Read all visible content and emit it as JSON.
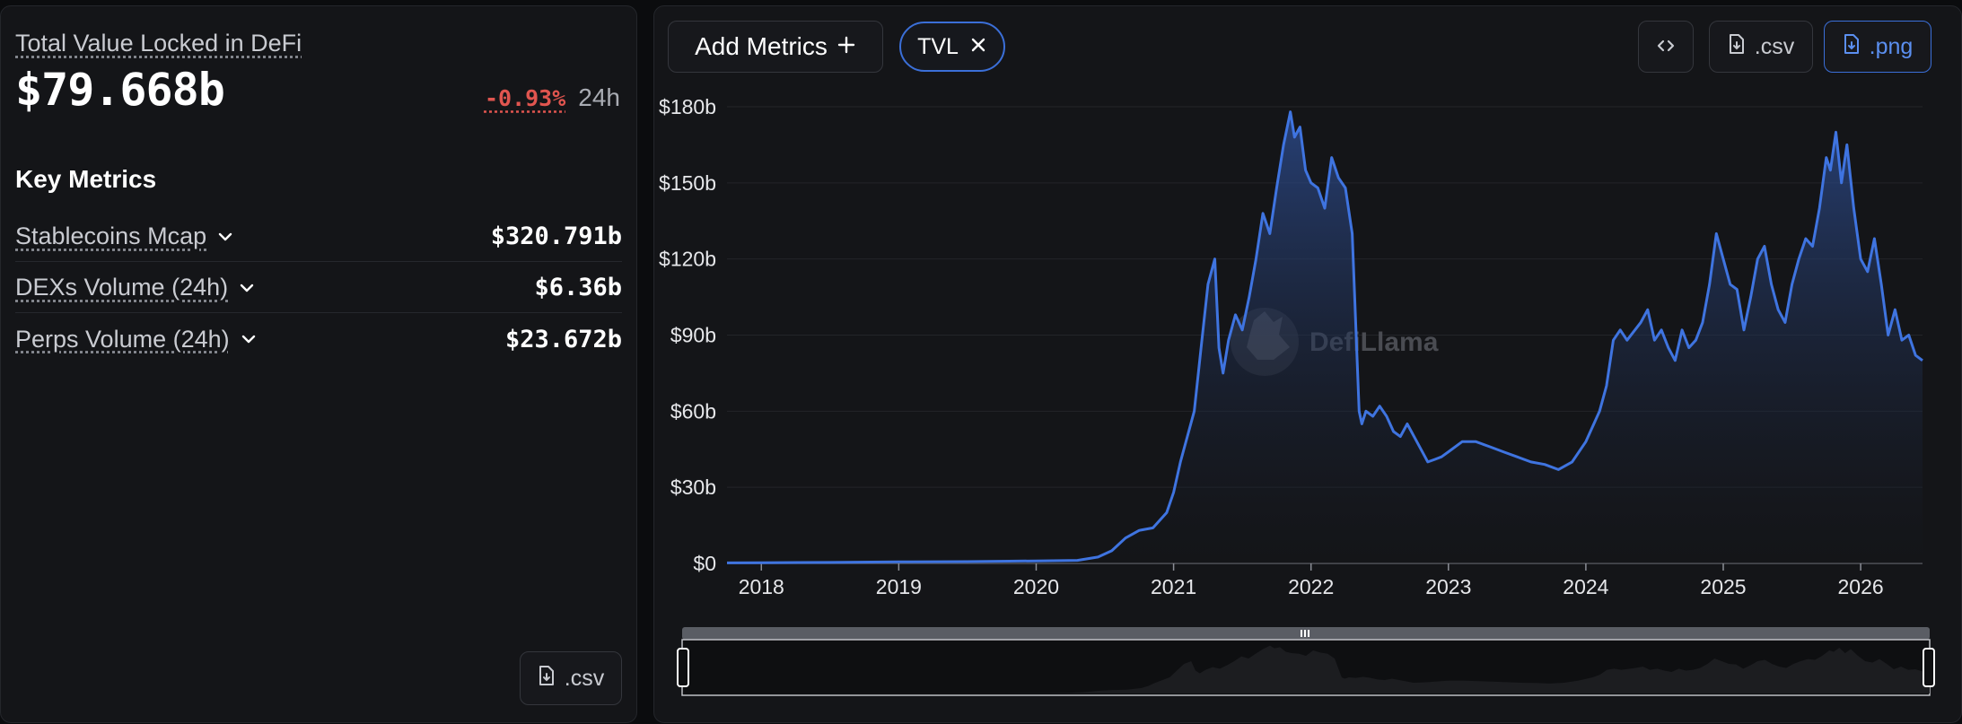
{
  "summary": {
    "title": "Total Value Locked in DeFi",
    "value": "$79.668b",
    "change": "-0.93%",
    "change_period": "24h"
  },
  "key_metrics": {
    "title": "Key Metrics",
    "items": [
      {
        "label": "Stablecoins Mcap",
        "value": "$320.791b"
      },
      {
        "label": "DEXs Volume (24h)",
        "value": "$6.36b"
      },
      {
        "label": "Perps Volume (24h)",
        "value": "$23.672b"
      }
    ]
  },
  "left_csv_label": ".csv",
  "toolbar": {
    "add_metrics_label": "Add Metrics",
    "tvl_chip_label": "TVL",
    "csv_label": ".csv",
    "png_label": ".png"
  },
  "watermark": "DefiLlama",
  "colors": {
    "accent": "#3b6fd8",
    "negative": "#e0554f",
    "line": "#3f74e0"
  },
  "chart_data": {
    "type": "area",
    "y_tick_labels": [
      "$0",
      "$30b",
      "$60b",
      "$90b",
      "$120b",
      "$150b",
      "$180b"
    ],
    "x_tick_labels": [
      "2018",
      "2019",
      "2020",
      "2021",
      "2022",
      "2023",
      "2024",
      "2025",
      "2026"
    ],
    "ylim": [
      0,
      180
    ],
    "xlim": [
      2017.75,
      2026.45
    ],
    "grid": true,
    "series": [
      {
        "values_unit": "billion USD",
        "x": [
          2017.75,
          2018.0,
          2018.5,
          2019.0,
          2019.5,
          2019.8,
          2020.0,
          2020.3,
          2020.45,
          2020.55,
          2020.65,
          2020.75,
          2020.85,
          2020.95,
          2021.0,
          2021.05,
          2021.1,
          2021.15,
          2021.2,
          2021.25,
          2021.3,
          2021.33,
          2021.36,
          2021.4,
          2021.45,
          2021.5,
          2021.55,
          2021.6,
          2021.65,
          2021.7,
          2021.75,
          2021.8,
          2021.85,
          2021.88,
          2021.92,
          2021.96,
          2022.0,
          2022.05,
          2022.1,
          2022.15,
          2022.2,
          2022.25,
          2022.3,
          2022.35,
          2022.37,
          2022.4,
          2022.45,
          2022.5,
          2022.55,
          2022.6,
          2022.65,
          2022.7,
          2022.75,
          2022.8,
          2022.85,
          2022.9,
          2022.95,
          2023.0,
          2023.1,
          2023.2,
          2023.3,
          2023.4,
          2023.5,
          2023.6,
          2023.7,
          2023.8,
          2023.9,
          2024.0,
          2024.1,
          2024.15,
          2024.2,
          2024.25,
          2024.3,
          2024.4,
          2024.45,
          2024.5,
          2024.55,
          2024.6,
          2024.65,
          2024.7,
          2024.75,
          2024.8,
          2024.85,
          2024.9,
          2024.95,
          2025.0,
          2025.05,
          2025.1,
          2025.15,
          2025.2,
          2025.25,
          2025.3,
          2025.35,
          2025.4,
          2025.45,
          2025.5,
          2025.55,
          2025.6,
          2025.65,
          2025.7,
          2025.75,
          2025.78,
          2025.82,
          2025.86,
          2025.9,
          2025.95,
          2026.0,
          2026.05,
          2026.1,
          2026.15,
          2026.2,
          2026.25,
          2026.3,
          2026.35,
          2026.4,
          2026.45
        ],
        "y": [
          0.2,
          0.3,
          0.4,
          0.6,
          0.7,
          0.9,
          1.0,
          1.2,
          2.5,
          5,
          10,
          13,
          14,
          20,
          28,
          40,
          50,
          60,
          85,
          110,
          120,
          85,
          75,
          88,
          98,
          92,
          105,
          120,
          138,
          130,
          148,
          165,
          178,
          168,
          172,
          155,
          150,
          148,
          140,
          160,
          152,
          148,
          130,
          60,
          55,
          60,
          58,
          62,
          58,
          52,
          50,
          55,
          50,
          45,
          40,
          41,
          42,
          44,
          48,
          48,
          46,
          44,
          42,
          40,
          39,
          37,
          40,
          48,
          60,
          70,
          88,
          92,
          88,
          95,
          100,
          88,
          92,
          85,
          80,
          92,
          85,
          88,
          95,
          110,
          130,
          120,
          110,
          108,
          92,
          105,
          120,
          125,
          110,
          100,
          95,
          110,
          120,
          128,
          125,
          140,
          160,
          155,
          170,
          150,
          165,
          140,
          120,
          115,
          128,
          110,
          90,
          100,
          88,
          90,
          82,
          80
        ]
      }
    ]
  }
}
